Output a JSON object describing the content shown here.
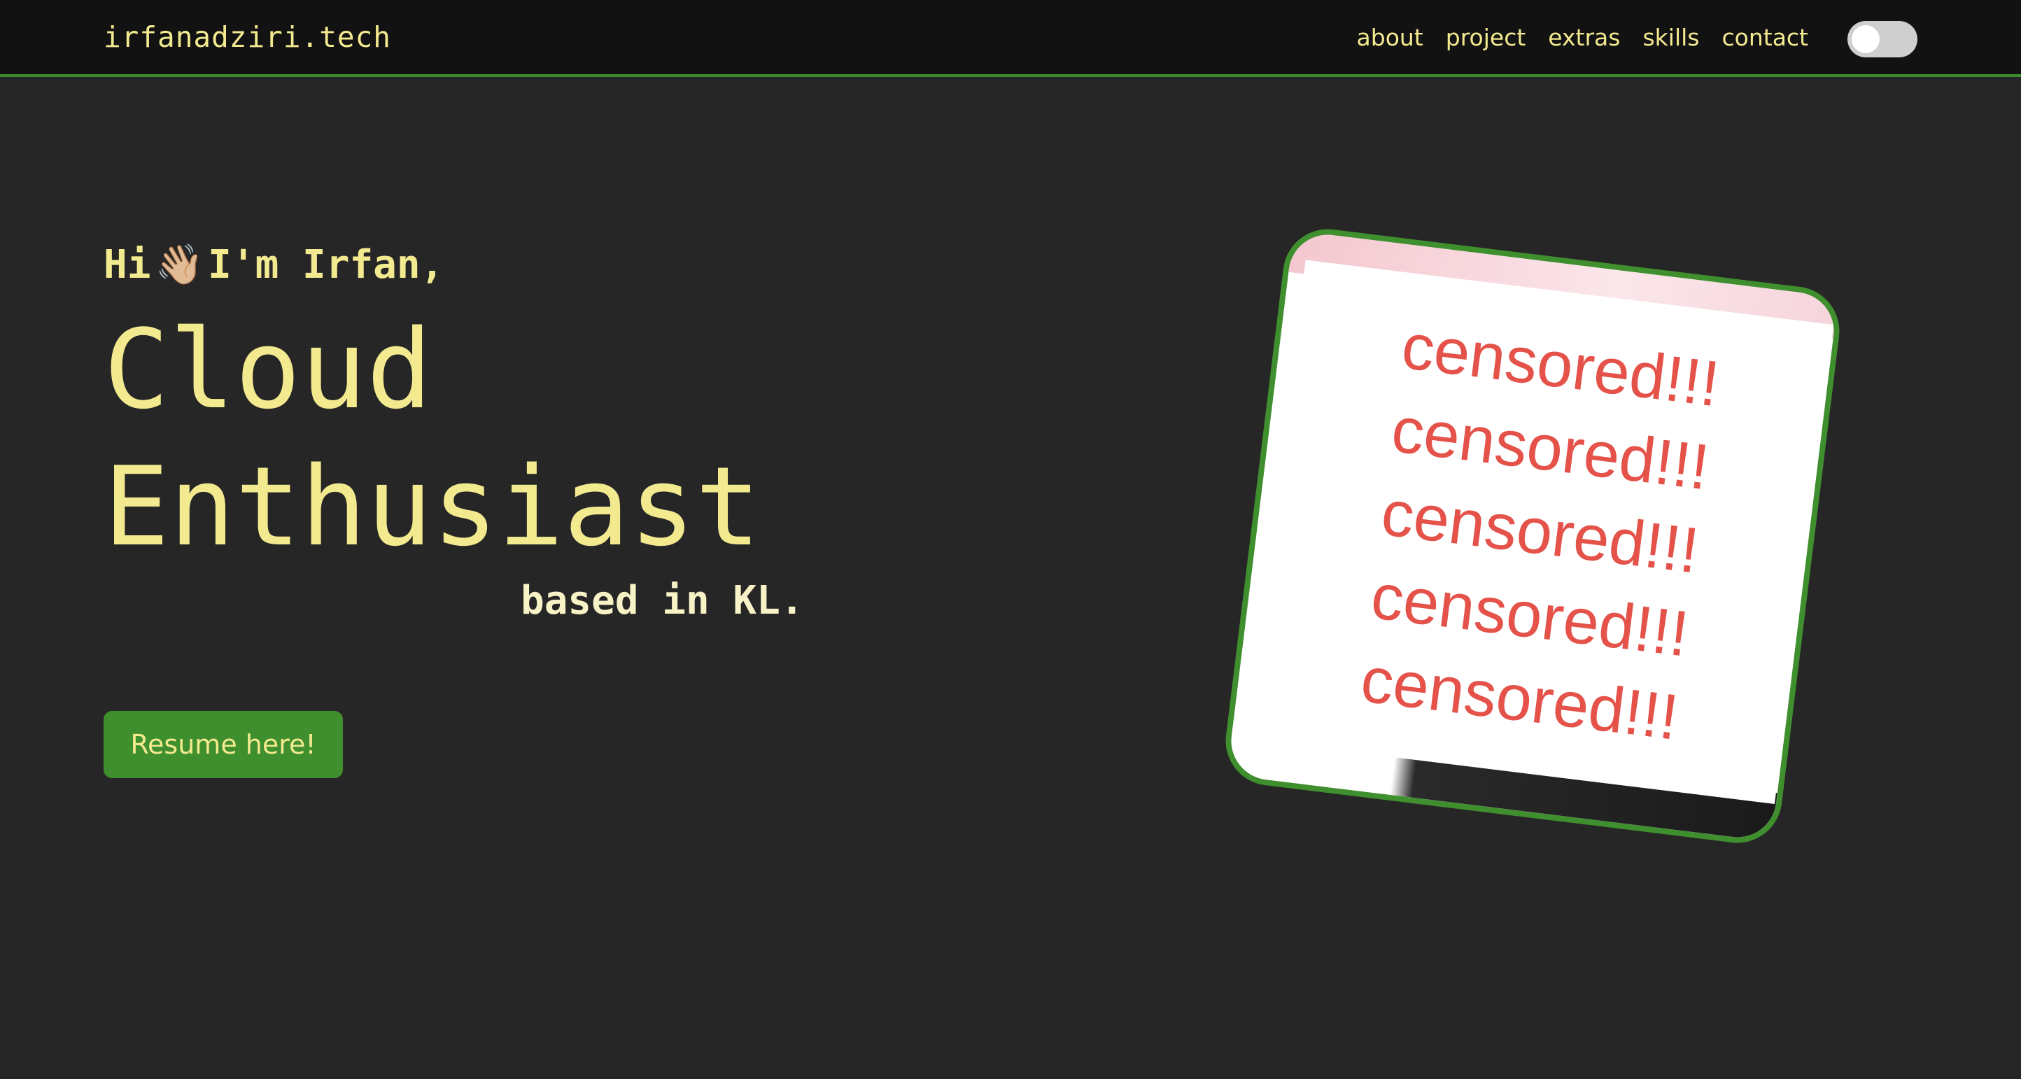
{
  "navbar": {
    "brand": "irfanadziri.tech",
    "links": [
      {
        "label": "about"
      },
      {
        "label": "project"
      },
      {
        "label": "extras"
      },
      {
        "label": "skills"
      },
      {
        "label": "contact"
      }
    ],
    "theme_toggle": {
      "state": "off"
    }
  },
  "hero": {
    "greeting_before": "Hi",
    "greeting_emoji": "👋🏼",
    "greeting_after": "I'm Irfan,",
    "headline_line1": "Cloud",
    "headline_line2": "Enthusiast",
    "location": "based in KL.",
    "resume_button": "Resume here!"
  },
  "photo": {
    "censor_lines": [
      "censored!!!",
      "censored!!!",
      "censored!!!",
      "censored!!!",
      "censored!!!"
    ]
  },
  "colors": {
    "background": "#262626",
    "navbar": "#121212",
    "accent_green": "#3f8f2e",
    "text_yellow": "#f3ea90",
    "censor_red": "#e4524a"
  }
}
